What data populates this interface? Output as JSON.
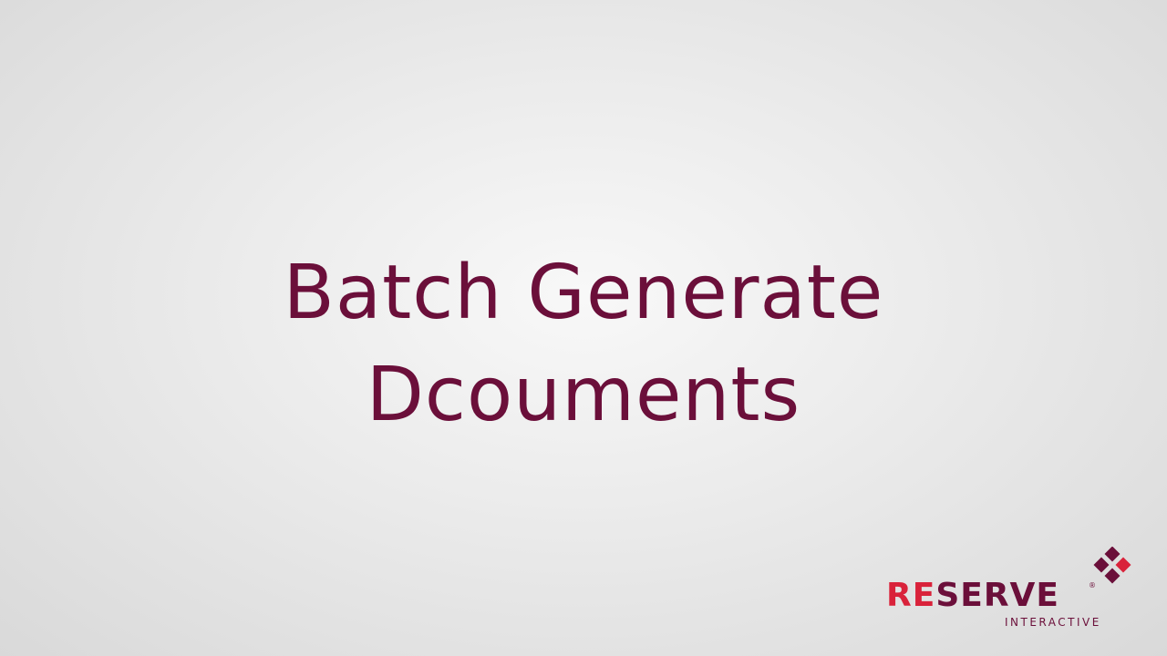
{
  "title": {
    "line1": "Batch Generate",
    "line2": "Dcouments"
  },
  "logo": {
    "word_accent": "RE",
    "word_main": "SERVE",
    "registered": "®",
    "subtitle": "INTERACTIVE",
    "mark_icon": "diamond-cluster-icon"
  },
  "colors": {
    "title": "#6b0f3a",
    "accent_red": "#d9223a",
    "brand_maroon": "#6b0f3a"
  }
}
